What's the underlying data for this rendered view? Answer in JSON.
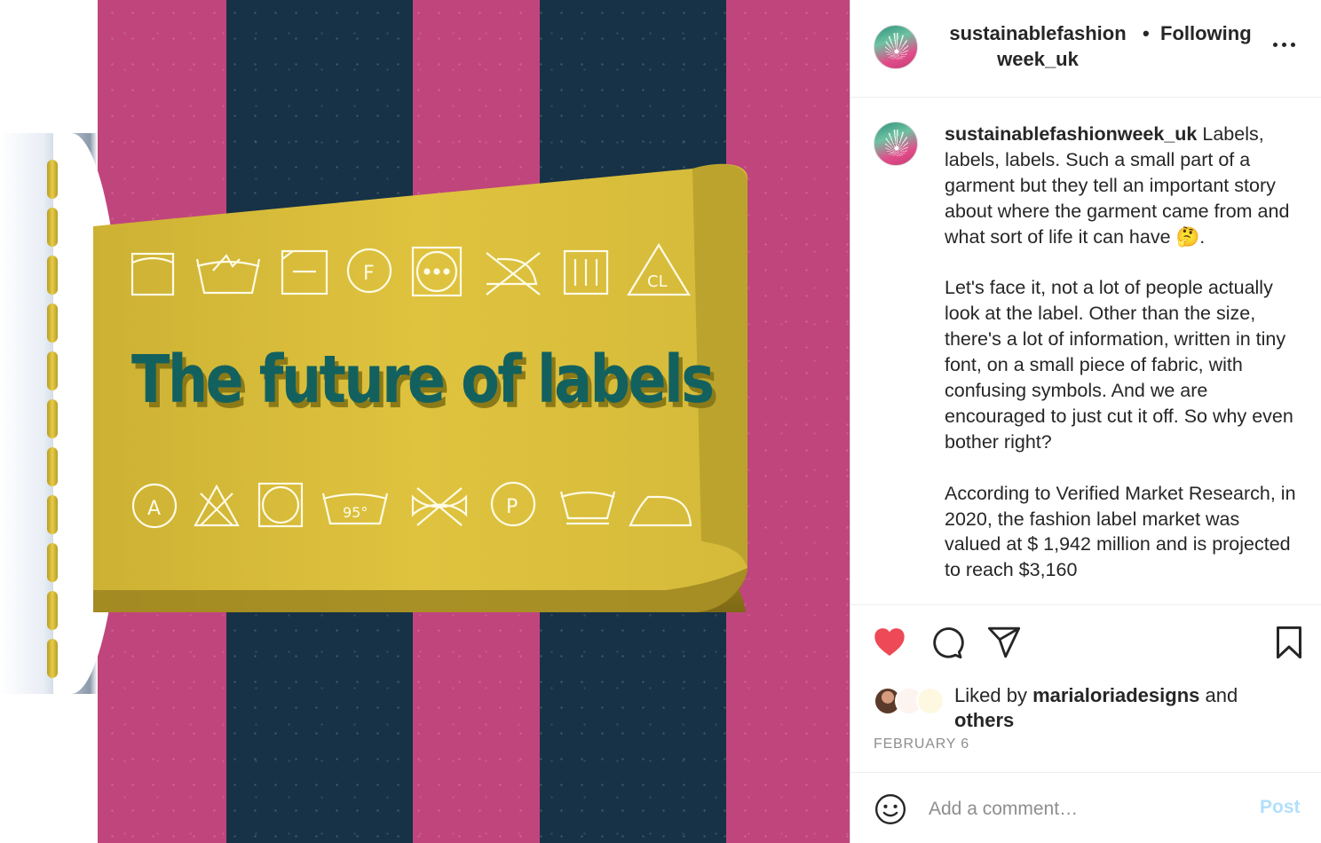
{
  "post": {
    "image": {
      "headline": "The future of labels",
      "icons_top": [
        "tumble-dry-square-icon",
        "hand-wash-icon",
        "dry-flat-icon",
        "dry-clean-f-icon",
        "tumble-dry-high-icon",
        "do-not-iron-icon",
        "drip-dry-icon",
        "chlorine-bleach-cl-icon"
      ],
      "icons_bottom": [
        "dry-clean-a-icon",
        "do-not-bleach-icon",
        "tumble-dry-icon",
        "wash-95-icon",
        "do-not-wring-icon",
        "dry-clean-p-icon",
        "wash-gentle-icon",
        "iron-icon"
      ],
      "icon_texts": {
        "f": "F",
        "cl": "CL",
        "a": "A",
        "p": "P",
        "temp": "95°"
      },
      "colors": {
        "pink": "#c0457c",
        "navy": "#173246",
        "label_yellow": "#dcc13e",
        "title_teal": "#13615f"
      }
    },
    "header": {
      "username_line1": "sustainablefashion",
      "username_line2": "week_uk",
      "dot": "•",
      "follow_label": "Following"
    },
    "caption": {
      "username": "sustainablefashionweek_uk",
      "paragraph_1": "Labels, labels, labels. Such a small part of a garment but they tell an important story about where the garment came from and what sort of life it can have 🤔.",
      "paragraph_2": "Let's face it, not a lot of people actually look at the label. Other than the size, there's a lot of information, written in tiny font, on a small piece of fabric, with confusing symbols. And we are encouraged to just cut it off. So why even bother right?",
      "paragraph_3": "According to Verified Market Research, in 2020, the fashion label market was valued at $ 1,942 million and is projected to reach $3,160"
    },
    "likes": {
      "prefix": "Liked by",
      "user": "marialoriadesigns",
      "joiner": "and",
      "others": "others"
    },
    "date": "FEBRUARY 6",
    "comment": {
      "placeholder": "Add a comment…",
      "post_label": "Post"
    },
    "accent_colors": {
      "heart": "#ed4956",
      "post_disabled": "#b2dffc"
    }
  }
}
